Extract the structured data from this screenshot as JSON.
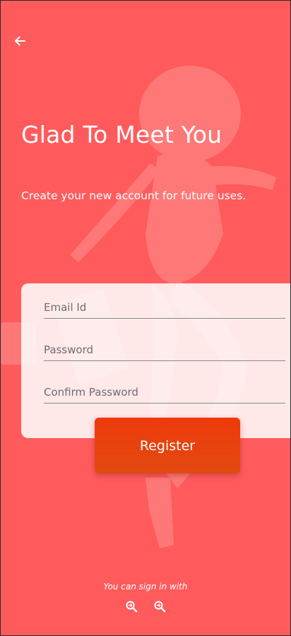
{
  "page": {
    "title": "Glad To Meet You",
    "subtitle": "Create your new account for future uses."
  },
  "form": {
    "email_placeholder": "Email Id",
    "password_placeholder": "Password",
    "confirm_placeholder": "Confirm Password",
    "register_label": "Register"
  },
  "footer": {
    "signin_text": "You can sign in with",
    "social_icons": [
      "google-search-icon",
      "facebook-search-icon"
    ]
  },
  "colors": {
    "background": "#ff5b5c",
    "button": "#ee3a0b",
    "text": "#ffffff"
  }
}
